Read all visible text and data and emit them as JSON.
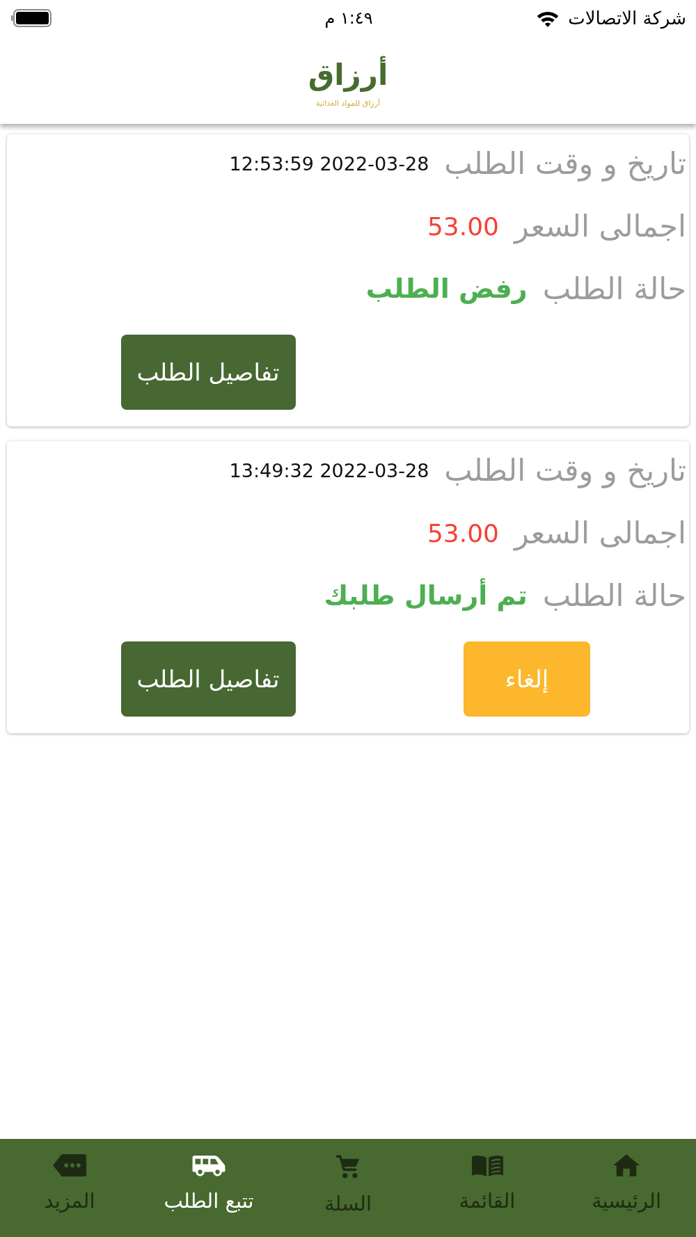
{
  "status_bar": {
    "carrier": "شركة الاتصالات",
    "time": "١:٤٩ م"
  },
  "header": {
    "logo": {
      "name": "أرزاق",
      "tagline": "أرزاق للمواد الغذائية"
    }
  },
  "orders": [
    {
      "fields": [
        {
          "kind": "datetime",
          "label": "تاريخ و وقت الطلب",
          "value": "12:53:59 2022-03-28"
        },
        {
          "kind": "price",
          "label": "اجمالى السعر",
          "value": "53.00"
        },
        {
          "kind": "status",
          "label": "حالة الطلب",
          "value": "رفض الطلب"
        }
      ],
      "buttons": [
        {
          "kind": "details",
          "label": "تفاصيل الطلب"
        }
      ]
    },
    {
      "fields": [
        {
          "kind": "datetime",
          "label": "تاريخ و وقت الطلب",
          "value": "13:49:32 2022-03-28"
        },
        {
          "kind": "price",
          "label": "اجمالى السعر",
          "value": "53.00"
        },
        {
          "kind": "status",
          "label": "حالة الطلب",
          "value": "تم أرسال طلبك"
        }
      ],
      "buttons": [
        {
          "kind": "cancel",
          "label": "إلغاء"
        },
        {
          "kind": "details",
          "label": "تفاصيل الطلب"
        }
      ]
    }
  ],
  "bottom_nav": {
    "items": [
      {
        "label": "الرئيسية",
        "selected": false
      },
      {
        "label": "القائمة",
        "selected": false
      },
      {
        "label": "السلة",
        "selected": false
      },
      {
        "label": "تتبع الطلب",
        "selected": true
      },
      {
        "label": "المزيد",
        "selected": false
      }
    ]
  }
}
